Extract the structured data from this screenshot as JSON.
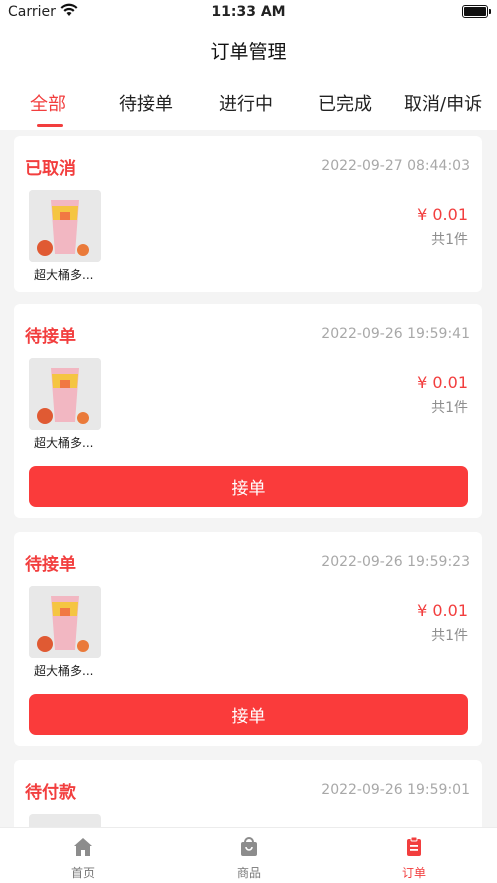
{
  "status_bar": {
    "carrier": "Carrier",
    "time": "11:33 AM"
  },
  "nav": {
    "title": "订单管理"
  },
  "tabs": [
    {
      "label": "全部",
      "active": true
    },
    {
      "label": "待接单",
      "active": false
    },
    {
      "label": "进行中",
      "active": false
    },
    {
      "label": "已完成",
      "active": false
    },
    {
      "label": "取消/申诉",
      "active": false
    }
  ],
  "orders": [
    {
      "status": "已取消",
      "time": "2022-09-27 08:44:03",
      "product_name": "超大桶多...",
      "price": "¥ 0.01",
      "quantity": "共1件",
      "action": ""
    },
    {
      "status": "待接单",
      "time": "2022-09-26 19:59:41",
      "product_name": "超大桶多...",
      "price": "¥ 0.01",
      "quantity": "共1件",
      "action": "接单"
    },
    {
      "status": "待接单",
      "time": "2022-09-26 19:59:23",
      "product_name": "超大桶多...",
      "price": "¥ 0.01",
      "quantity": "共1件",
      "action": "接单"
    },
    {
      "status": "待付款",
      "time": "2022-09-26 19:59:01",
      "product_name": "",
      "price": "",
      "quantity": "",
      "action": ""
    }
  ],
  "tabbar": [
    {
      "label": "首页",
      "icon": "home-icon",
      "active": false
    },
    {
      "label": "商品",
      "icon": "bag-icon",
      "active": false
    },
    {
      "label": "订单",
      "icon": "order-icon",
      "active": true
    }
  ],
  "colors": {
    "accent": "#f23e3e",
    "button": "#fa3b3b",
    "background": "#f4f4f4"
  }
}
